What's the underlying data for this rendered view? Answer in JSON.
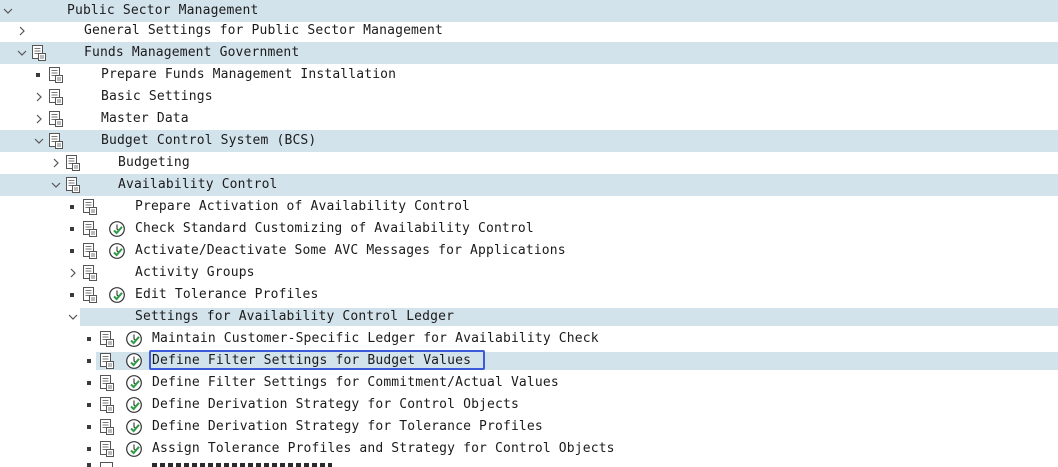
{
  "tree": {
    "rows": [
      {
        "label": "Public Sector Management"
      },
      {
        "label": "General Settings for Public Sector Management"
      },
      {
        "label": "Funds Management Government"
      },
      {
        "label": "Prepare Funds Management Installation"
      },
      {
        "label": "Basic Settings"
      },
      {
        "label": "Master Data"
      },
      {
        "label": "Budget Control System (BCS)"
      },
      {
        "label": "Budgeting"
      },
      {
        "label": "Availability Control"
      },
      {
        "label": "Prepare Activation of Availability Control"
      },
      {
        "label": "Check Standard Customizing of Availability Control"
      },
      {
        "label": "Activate/Deactivate Some AVC Messages for Applications"
      },
      {
        "label": "Activity Groups"
      },
      {
        "label": "Edit Tolerance Profiles"
      },
      {
        "label": "Settings for Availability Control Ledger"
      },
      {
        "label": "Maintain Customer-Specific Ledger for Availability Check"
      },
      {
        "label": "Define Filter Settings for Budget Values"
      },
      {
        "label": "Define Filter Settings for Commitment/Actual Values"
      },
      {
        "label": "Define Derivation Strategy for Control Objects"
      },
      {
        "label": "Define Derivation Strategy for Tolerance Profiles"
      },
      {
        "label": "Assign Tolerance Profiles and Strategy for Control Objects"
      }
    ]
  },
  "icons": {
    "doc": "img-activity-icon",
    "exec": "execute-clock-check-icon",
    "expand_collapsed": "chevron-right-icon",
    "expand_open": "chevron-down-icon",
    "leaf": "bullet-icon"
  },
  "colors": {
    "row_highlight": "#d3e3ec",
    "selection_border": "#3b5bdb",
    "exec_check": "#2e9b46"
  }
}
